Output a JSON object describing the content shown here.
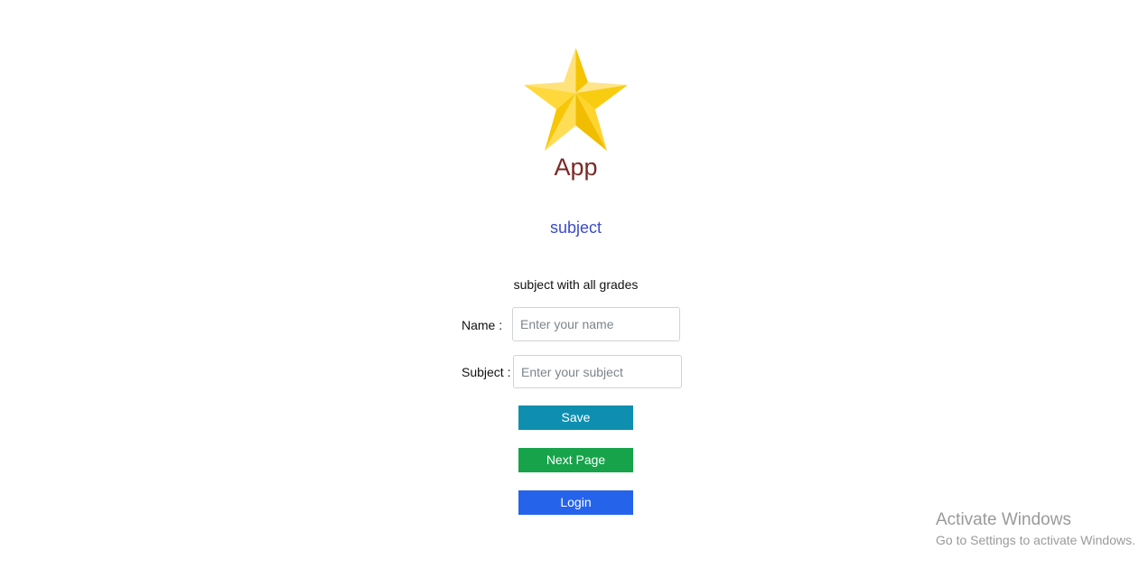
{
  "app": {
    "title": "App",
    "logo_icon": "star-icon"
  },
  "subject_heading": "subject",
  "form": {
    "description": "subject with all grades",
    "name_label": "Name :",
    "name_placeholder": "Enter your name",
    "name_value": "",
    "subject_label": "Subject :",
    "subject_placeholder": "Enter your subject",
    "subject_value": ""
  },
  "buttons": {
    "save_label": "Save",
    "next_label": "Next Page",
    "login_label": "Login"
  },
  "watermark": {
    "title": "Activate Windows",
    "subtitle": "Go to Settings to activate Windows."
  },
  "colors": {
    "title": "#7a2a26",
    "subject_heading": "#3b4cc9",
    "save_button": "#0e8fb0",
    "next_button": "#16a34a",
    "login_button": "#2563eb",
    "star_light": "#ffe27a",
    "star_mid": "#ffd42e",
    "star_dark": "#f5c400"
  }
}
